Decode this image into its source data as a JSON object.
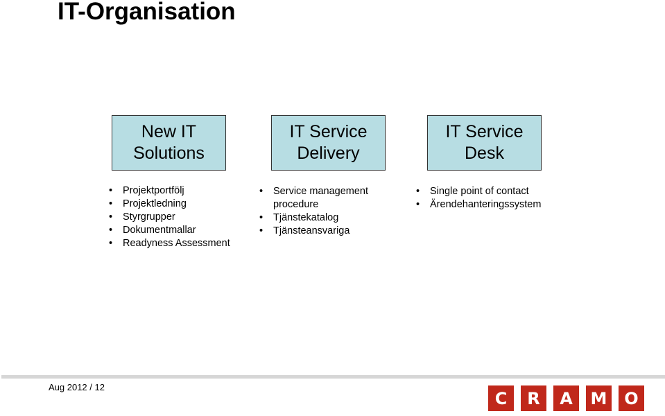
{
  "title": "IT-Organisation",
  "columns": [
    {
      "heading_line1": "New IT",
      "heading_line2": "Solutions",
      "items": [
        "Projektportfölj",
        "Projektledning",
        "Styrgrupper",
        "Dokumentmallar",
        "Readyness Assessment"
      ]
    },
    {
      "heading_line1": "IT Service",
      "heading_line2": "Delivery",
      "items": [
        "Service management procedure",
        "Tjänstekatalog",
        "Tjänsteansvariga"
      ]
    },
    {
      "heading_line1": "IT Service",
      "heading_line2": "Desk",
      "items": [
        "Single point of contact",
        "Ärendehanteringssystem"
      ]
    }
  ],
  "bullet": "•",
  "footer": {
    "text": "Aug 2012 / 12"
  },
  "logo": {
    "letters": [
      "C",
      "R",
      "A",
      "M",
      "O"
    ],
    "color": "#c0281b"
  },
  "colors": {
    "box_fill": "#b7dde3"
  }
}
